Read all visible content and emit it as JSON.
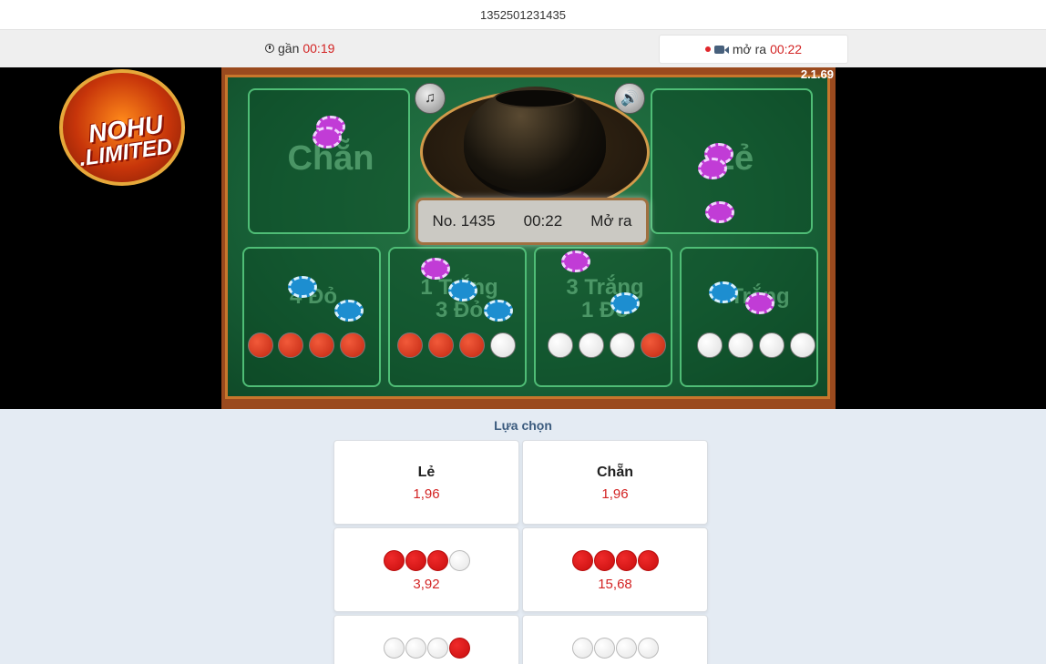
{
  "header": {
    "game_id": "1352501231435"
  },
  "timers": {
    "close_label": "gần",
    "close_time": "00:19",
    "open_label": "mở ra",
    "open_time": "00:22"
  },
  "video": {
    "version": "2.1.69",
    "info": {
      "number": "No. 1435",
      "time": "00:22",
      "status": "Mở ra"
    },
    "zones": {
      "chan": "Chẵn",
      "le": "Lẻ",
      "four_red": "4 Đỏ",
      "one_white_three_red": "1 Trắng\n3 Đỏ",
      "three_white_one_red": "3 Trắng\n1 Đỏ",
      "four_white": "4 Trắng"
    },
    "logo": {
      "line1": "NOHU",
      "line2": ".LIMITED"
    }
  },
  "choices": {
    "title": "Lựa chọn",
    "cards": [
      {
        "label": "Lẻ",
        "odds": "1,96"
      },
      {
        "label": "Chẵn",
        "odds": "1,96"
      },
      {
        "balls": [
          "red",
          "red",
          "red",
          "white"
        ],
        "odds": "3,92"
      },
      {
        "balls": [
          "red",
          "red",
          "red",
          "red"
        ],
        "odds": "15,68"
      },
      {
        "balls": [
          "white",
          "white",
          "white",
          "red"
        ]
      },
      {
        "balls": [
          "white",
          "white",
          "white",
          "white"
        ]
      }
    ]
  },
  "colors": {
    "accent_red": "#d32424",
    "title_blue": "#3b5b7e",
    "felt_green": "#196339"
  }
}
